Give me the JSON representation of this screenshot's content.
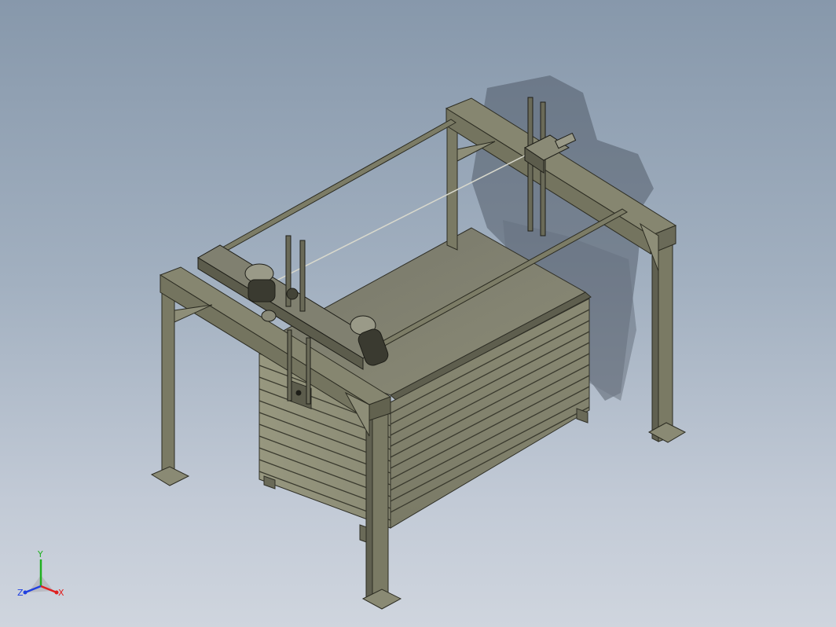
{
  "viewport": {
    "view": "isometric",
    "background_top": "#8798ab",
    "background_bottom": "#cfd5de"
  },
  "model": {
    "frame_color": "#74745f",
    "container_color": "#86866e",
    "shadow_color": "#3c4450"
  },
  "triad": {
    "x_label": "X",
    "y_label": "Y",
    "z_label": "Z",
    "x_color": "#e02020",
    "y_color": "#20b020",
    "z_color": "#2040e0"
  }
}
